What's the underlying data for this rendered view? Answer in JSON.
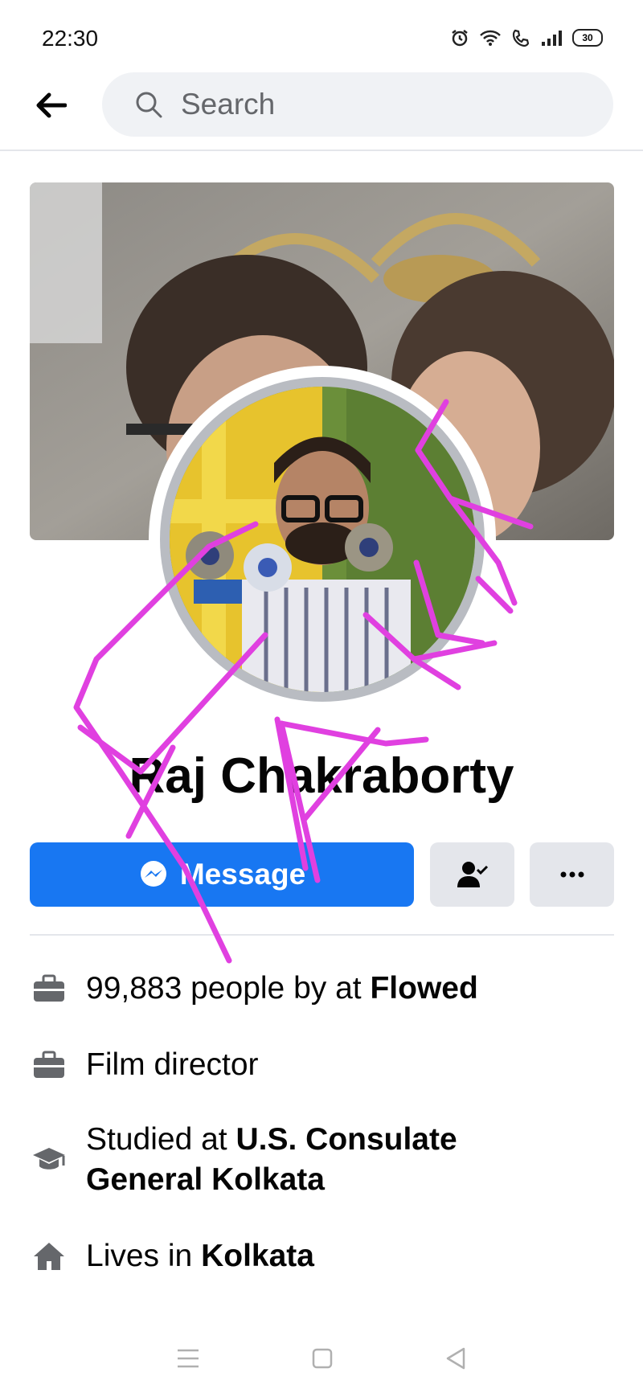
{
  "status_bar": {
    "time": "22:30",
    "battery": "30",
    "icons": [
      "alarm-icon",
      "wifi-icon",
      "call-icon",
      "signal-icon",
      "battery-icon"
    ]
  },
  "header": {
    "search_placeholder": "Search"
  },
  "profile": {
    "name": "Raj Chakraborty"
  },
  "actions": {
    "message_label": "Message"
  },
  "details": [
    {
      "icon": "briefcase-icon",
      "prefix": "99,883 people by at ",
      "bold": "Flowed"
    },
    {
      "icon": "briefcase-icon",
      "prefix": "Film director",
      "bold": ""
    },
    {
      "icon": "graduation-cap-icon",
      "prefix": "Studied at ",
      "bold": "U.S. Consulate General Kolkata"
    },
    {
      "icon": "home-icon",
      "prefix": "Lives in ",
      "bold": "Kolkata"
    }
  ],
  "colors": {
    "accent": "#1877f2",
    "button_gray": "#e4e6eb",
    "scribble": "#e040e0"
  }
}
